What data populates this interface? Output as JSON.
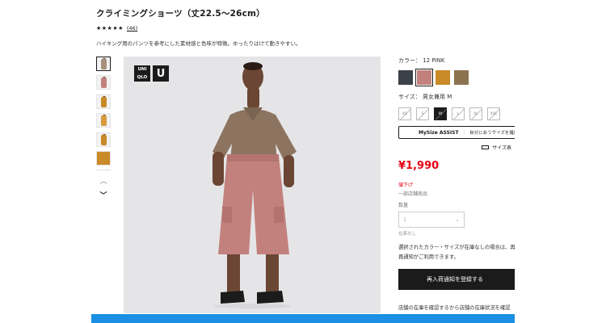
{
  "product": {
    "title": "クライミングショーツ（丈22.5〜26cm）",
    "stars": "★★★★★",
    "review_count": "(46)",
    "description": "ハイキング用のパンツを参考にした素材感と色味が特徴。ゆったりはけて動きやすい。"
  },
  "gallery": {
    "logo_line1": "UNI",
    "logo_line2": "QLO",
    "logo_u": "U",
    "next_arrow": "›",
    "thumb_up": "︿",
    "thumb_down": "﹀"
  },
  "color": {
    "label": "カラー： 12 PINK",
    "swatches": [
      "#3b4148",
      "#c2817c",
      "#c98a28",
      "#8c7350"
    ],
    "selected_index": 1
  },
  "size": {
    "label": "サイズ： 男女兼用 M",
    "options": [
      "XS",
      "S",
      "M",
      "L",
      "XL",
      "XXL"
    ],
    "selected_index": 2
  },
  "mysize": {
    "brand": "MySize ASSIST",
    "separator": "｜",
    "text": "自分にあうサイズを確認する"
  },
  "size_guide": "サイズ表",
  "price": "¥1,990",
  "discount": "値下げ",
  "stock_note": "一部店舗商品",
  "quantity": {
    "label": "数量",
    "value": "1",
    "chevron": "⌄",
    "status": "在庫なし"
  },
  "notice": {
    "line1": "選択されたカラー・サイズが在庫なしの場合は、再入荷",
    "line2": "再通知がご利用できます。"
  },
  "restock_button": "再入荷通知を登録する",
  "store_check": "店舗の在庫を確認するから店舗の在庫状況を確認"
}
